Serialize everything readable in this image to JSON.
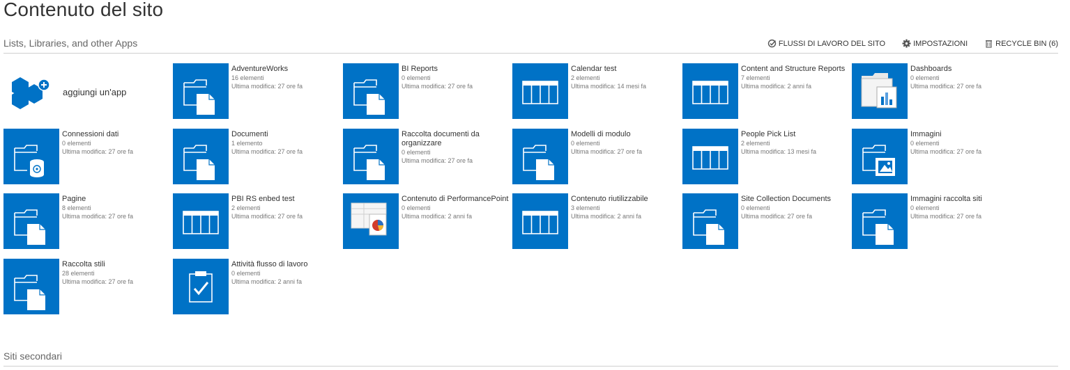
{
  "page": {
    "title": "Contenuto del sito"
  },
  "apps_section": {
    "title": "Lists, Libraries, and other Apps",
    "toolbar": {
      "workflows": "FLUSSI DI LAVORO DEL SITO",
      "settings": "IMPOSTAZIONI",
      "recycle_bin": "RECYCLE BIN (6)"
    }
  },
  "add_app": {
    "label": "aggiungi un'app"
  },
  "tiles": [
    {
      "name": "AdventureWorks",
      "count": "16 elementi",
      "modified": "Ultima modifica: 27 ore fa",
      "icon": "library-icon"
    },
    {
      "name": "BI Reports",
      "count": "0 elementi",
      "modified": "Ultima modifica: 27 ore fa",
      "icon": "library-icon"
    },
    {
      "name": "Calendar test",
      "count": "2 elementi",
      "modified": "Ultima modifica: 14 mesi fa",
      "icon": "list-icon"
    },
    {
      "name": "Content and Structure Reports",
      "count": "7 elementi",
      "modified": "Ultima modifica: 2 anni fa",
      "icon": "list-icon"
    },
    {
      "name": "Dashboards",
      "count": "0 elementi",
      "modified": "Ultima modifica: 27 ore fa",
      "icon": "dashboard-library-icon"
    },
    {
      "name": "Connessioni dati",
      "count": "0 elementi",
      "modified": "Ultima modifica: 27 ore fa",
      "icon": "data-connection-library-icon"
    },
    {
      "name": "Documenti",
      "count": "1 elemento",
      "modified": "Ultima modifica: 27 ore fa",
      "icon": "library-icon"
    },
    {
      "name": "Raccolta documenti da organizzare",
      "count": "0 elementi",
      "modified": "Ultima modifica: 27 ore fa",
      "icon": "library-icon"
    },
    {
      "name": "Modelli di modulo",
      "count": "0 elementi",
      "modified": "Ultima modifica: 27 ore fa",
      "icon": "library-icon"
    },
    {
      "name": "People Pick List",
      "count": "2 elementi",
      "modified": "Ultima modifica: 13 mesi fa",
      "icon": "list-icon"
    },
    {
      "name": "Immagini",
      "count": "0 elementi",
      "modified": "Ultima modifica: 27 ore fa",
      "icon": "picture-library-icon"
    },
    {
      "name": "Pagine",
      "count": "8 elementi",
      "modified": "Ultima modifica: 27 ore fa",
      "icon": "library-icon"
    },
    {
      "name": "PBI RS enbed test",
      "count": "2 elementi",
      "modified": "Ultima modifica: 27 ore fa",
      "icon": "list-icon"
    },
    {
      "name": "Contenuto di PerformancePoint",
      "count": "0 elementi",
      "modified": "Ultima modifica: 2 anni fa",
      "icon": "performancepoint-icon"
    },
    {
      "name": "Contenuto riutilizzabile",
      "count": "3 elementi",
      "modified": "Ultima modifica: 2 anni fa",
      "icon": "list-icon"
    },
    {
      "name": "Site Collection Documents",
      "count": "0 elementi",
      "modified": "Ultima modifica: 27 ore fa",
      "icon": "library-icon"
    },
    {
      "name": "Immagini raccolta siti",
      "count": "0 elementi",
      "modified": "Ultima modifica: 27 ore fa",
      "icon": "library-icon"
    },
    {
      "name": "Raccolta stili",
      "count": "28 elementi",
      "modified": "Ultima modifica: 27 ore fa",
      "icon": "library-icon"
    },
    {
      "name": "Attività flusso di lavoro",
      "count": "0 elementi",
      "modified": "Ultima modifica: 2 anni fa",
      "icon": "tasks-icon"
    }
  ],
  "subsites_section": {
    "title": "Siti secondari"
  },
  "colors": {
    "tile_blue": "#0072c6",
    "divider": "#cfcfcf"
  }
}
